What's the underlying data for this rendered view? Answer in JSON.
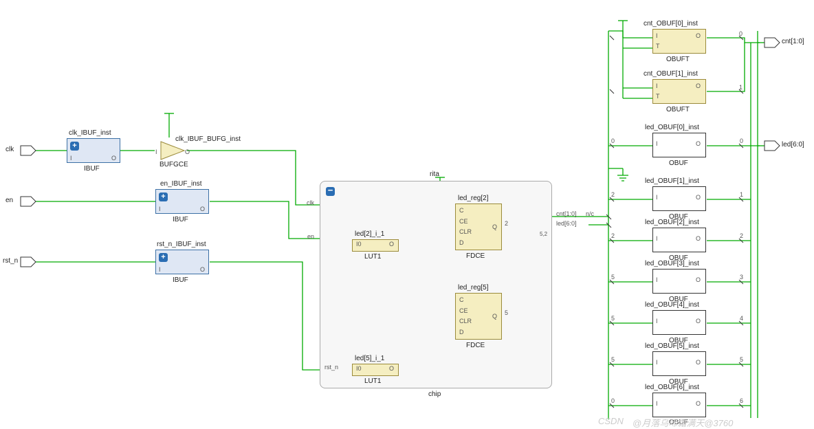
{
  "ports": {
    "clk": "clk",
    "en": "en",
    "rst_n": "rst_n",
    "cnt": "cnt[1:0]",
    "led": "led[6:0]"
  },
  "blocks": {
    "clk_ibuf_title": "clk_IBUF_inst",
    "clk_ibuf_type": "IBUF",
    "en_ibuf_title": "en_IBUF_inst",
    "en_ibuf_type": "IBUF",
    "rst_n_ibuf_title": "rst_n_IBUF_inst",
    "rst_n_ibuf_type": "IBUF",
    "bufgce_title": "clk_IBUF_BUFG_inst",
    "bufgce_type": "BUFGCE",
    "chip_title": "rita",
    "chip_type": "chip",
    "lut1_a_title": "led[2]_i_1",
    "lut1_a_type": "LUT1",
    "lut1_b_title": "led[5]_i_1",
    "lut1_b_type": "LUT1",
    "fdce_a_title": "led_reg[2]",
    "fdce_a_type": "FDCE",
    "fdce_b_title": "led_reg[5]",
    "fdce_b_type": "FDCE",
    "obuft0_title": "cnt_OBUF[0]_inst",
    "obuft0_type": "OBUFT",
    "obuft1_title": "cnt_OBUF[1]_inst",
    "obuft1_type": "OBUFT",
    "obuf0_title": "led_OBUF[0]_inst",
    "obuf0_type": "OBUF",
    "obuf1_title": "led_OBUF[1]_inst",
    "obuf1_type": "OBUF",
    "obuf2_title": "led_OBUF[2]_inst",
    "obuf2_type": "OBUF",
    "obuf3_title": "led_OBUF[3]_inst",
    "obuf3_type": "OBUF",
    "obuf4_title": "led_OBUF[4]_inst",
    "obuf4_type": "OBUF",
    "obuf5_title": "led_OBUF[5]_inst",
    "obuf5_type": "OBUF",
    "obuf6_title": "led_OBUF[6]_inst",
    "obuf6_type": "OBUF"
  },
  "pins": {
    "I": "I",
    "O": "O",
    "I0": "I0",
    "T": "T",
    "C": "C",
    "CE": "CE",
    "CLR": "CLR",
    "D": "D",
    "Q": "Q"
  },
  "internal_labels": {
    "clk": "clk",
    "en": "en",
    "rst_n": "rst_n",
    "cnt": "cnt[1:0]",
    "led": "led[6:0]",
    "nc": "n/c"
  },
  "bus_nums": {
    "b0": "0",
    "b1": "1",
    "b2": "2",
    "b3": "3",
    "b4": "4",
    "b5": "5",
    "b6": "6",
    "q2": "2",
    "q5": "5",
    "split52": "5,2"
  },
  "watermark_left": "CSDN",
  "watermark_right": "@月落乌啼霜满天@3760"
}
